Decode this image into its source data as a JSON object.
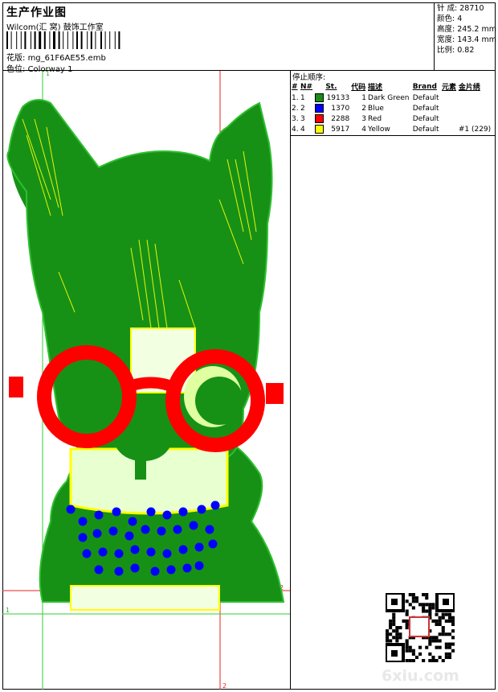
{
  "header": {
    "title": "生产作业图",
    "company": "Wilcom(汇 窝) 鼓饰工作室",
    "file_label": "花版:",
    "file_name": "mg_61F6AE55.emb",
    "colorway_label": "色位:",
    "colorway": "Colorway 1"
  },
  "stats": {
    "stitches_label": "针 成:",
    "stitches": "28710",
    "colors_label": "颜色:",
    "colors": "4",
    "height_label": "高度:",
    "height": "245.2 mm",
    "width_label": "宽度:",
    "width": "143.4 mm",
    "scale_label": "比例:",
    "scale": "0.82"
  },
  "stop_sequence": {
    "label": "停止顺序:",
    "columns": [
      "#",
      "N#",
      "St.",
      "代码",
      "描述",
      "Brand",
      "元素",
      "金片绣"
    ],
    "rows": [
      {
        "num": "1.",
        "n": "1",
        "color": "#1a8c1a",
        "stitches": "19133",
        "code": "1",
        "desc": "Dark Green",
        "brand": "Default",
        "element": "",
        "sequin": ""
      },
      {
        "num": "2.",
        "n": "2",
        "color": "#0000ff",
        "stitches": "1370",
        "code": "2",
        "desc": "Blue",
        "brand": "Default",
        "element": "",
        "sequin": ""
      },
      {
        "num": "3.",
        "n": "3",
        "color": "#ff0000",
        "stitches": "2288",
        "code": "3",
        "desc": "Red",
        "brand": "Default",
        "element": "",
        "sequin": ""
      },
      {
        "num": "4.",
        "n": "4",
        "color": "#ffff00",
        "stitches": "5917",
        "code": "4",
        "desc": "Yellow",
        "brand": "Default",
        "element": "",
        "sequin": "#1 (229)"
      }
    ]
  },
  "canvas": {
    "marker_top": "1",
    "marker_left": "1",
    "marker_right": "2",
    "marker_bottom": "2"
  },
  "watermark": "6xiu.com"
}
